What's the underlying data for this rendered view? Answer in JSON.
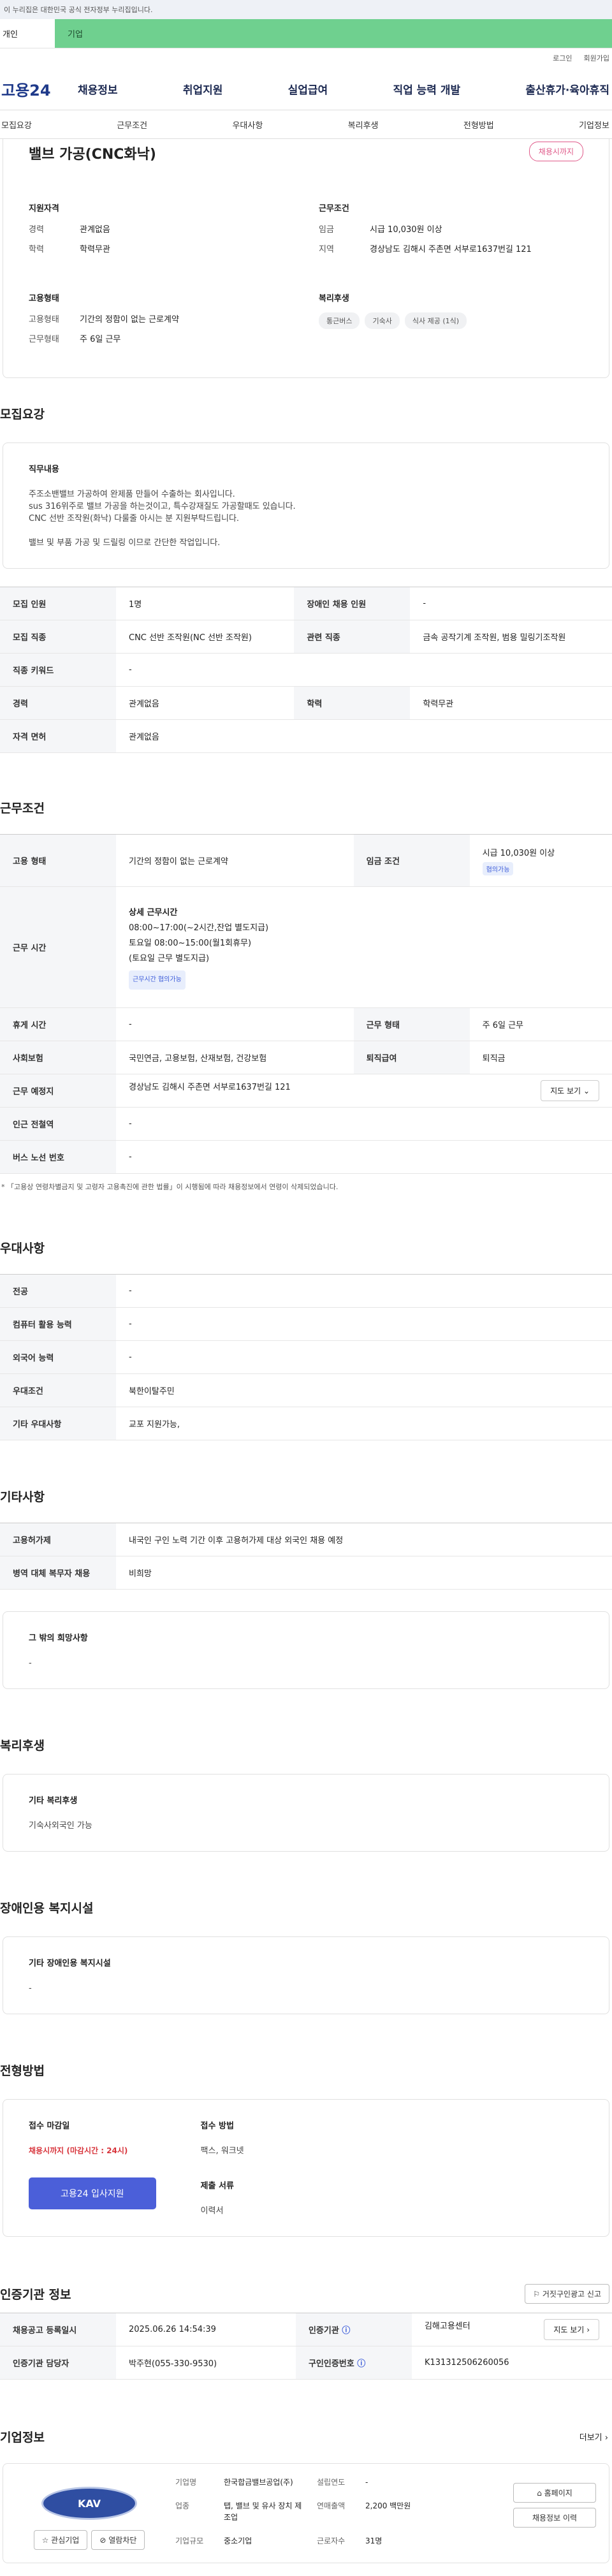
{
  "topbar": {
    "text": "이 누리집은 대한민국 공식 전자정부 누리집입니다."
  },
  "tabs": {
    "individual": "개인",
    "business": "기업"
  },
  "util": {
    "login": "로그인",
    "join": "회원가입"
  },
  "gnb": {
    "logo": "고용24",
    "menu": [
      "채용정보",
      "취업지원",
      "실업급여",
      "직업 능력 개발",
      "출산휴가·육아휴직"
    ]
  },
  "subnav": [
    "모집요강",
    "근무조건",
    "우대사항",
    "복리후생",
    "전형방법",
    "기업정보"
  ],
  "hero": {
    "title": "밸브 가공(CNC화낙)",
    "badge": "채용시까지",
    "qual_title": "지원자격",
    "qual": [
      {
        "k": "경력",
        "v": "관계없음"
      },
      {
        "k": "학력",
        "v": "학력무관"
      }
    ],
    "cond_title": "근무조건",
    "cond": [
      {
        "k": "임금",
        "v": "시급 10,030원 이상"
      },
      {
        "k": "지역",
        "v": "경상남도 김해시 주촌면 서부로1637번길 121"
      }
    ],
    "emp_title": "고용형태",
    "emp": [
      {
        "k": "고용형태",
        "v": "기간의 정함이 없는 근로계약"
      },
      {
        "k": "근무형태",
        "v": "주 6일 근무"
      }
    ],
    "welfare_title": "복리후생",
    "welfare": [
      "통근버스",
      "기숙사",
      "식사 제공 (1식)"
    ]
  },
  "recruit": {
    "title": "모집요강",
    "duty_title": "직무내용",
    "duty_lines": [
      "주조소밴밸브 가공하여 완제품 만들어 수출하는 회사입니다.",
      "sus 316위주로 밸브 가공을 하는것이고, 특수강재질도 가공할때도 있습니다.",
      "CNC 선반 조작원(화낙) 다룰줄 아시는 분 지원부탁드립니다.",
      "",
      "밸브 및 부품 가공 및 드릴링 이므로 간단한 작업입니다."
    ],
    "rows": [
      [
        {
          "k": "모집 인원",
          "v": "1명"
        },
        {
          "k": "장애인 채용 인원",
          "v": "-"
        }
      ],
      [
        {
          "k": "모집 직종",
          "v": "CNC 선반 조작원(NC 선반 조작원)"
        },
        {
          "k": "관련 직종",
          "v": "금속 공작기계 조작원, 범용 밀링기조작원"
        }
      ],
      [
        {
          "k": "직종 키워드",
          "v": "-"
        }
      ],
      [
        {
          "k": "경력",
          "v": "관계없음"
        },
        {
          "k": "학력",
          "v": "학력무관"
        }
      ],
      [
        {
          "k": "자격 면허",
          "v": "관계없음"
        }
      ]
    ]
  },
  "work": {
    "title": "근무조건",
    "emp_k": "고용 형태",
    "emp_v": "기간의 정함이 없는 근로계약",
    "wage_k": "임금 조건",
    "wage_v": "시급 10,030원 이상",
    "wage_chip": "협의가능",
    "time_k": "근무 시간",
    "time_lines": [
      "상세 근무시간",
      "08:00~17:00(~2시간,잔업 별도지급)",
      "토요일 08:00~15:00(월1회휴무)",
      "(토요일 근무 별도지급)"
    ],
    "time_chip": "근무시간 협의가능",
    "rows": [
      [
        {
          "k": "휴게 시간",
          "v": "-"
        },
        {
          "k": "근무 형태",
          "v": "주 6일 근무"
        }
      ],
      [
        {
          "k": "사회보험",
          "v": "국민연금, 고용보험, 산재보험, 건강보험"
        },
        {
          "k": "퇴직급여",
          "v": "퇴직금"
        }
      ]
    ],
    "place_k": "근무 예정지",
    "place_v": "경상남도 김해시 주촌면 서부로1637번길 121",
    "map_btn": "지도 보기",
    "station_k": "인근 전철역",
    "station_v": "-",
    "bus_k": "버스 노선 번호",
    "bus_v": "-",
    "note": "* 「고용상 연령차별금지 및 고령자 고용촉진에 관한 법률」이 시행됨에 따라 채용정보에서 연령이 삭제되었습니다."
  },
  "prefer": {
    "title": "우대사항",
    "rows": [
      {
        "k": "전공",
        "v": "-"
      },
      {
        "k": "컴퓨터 활용 능력",
        "v": "-"
      },
      {
        "k": "외국어 능력",
        "v": "-"
      },
      {
        "k": "우대조건",
        "v": "북한이탈주민"
      },
      {
        "k": "기타 우대사항",
        "v": "교포 지원가능,"
      }
    ]
  },
  "etc": {
    "title": "기타사항",
    "rows": [
      {
        "k": "고용허가제",
        "v": "내국인 구인 노력 기간 이후 고용허가제 대상 외국인 채용 예정"
      },
      {
        "k": "병역 대체 복무자 채용",
        "v": "비희망"
      }
    ],
    "box_title": "그 밖의 희망사항",
    "box_value": "-"
  },
  "welfare": {
    "title": "복리후생",
    "box_title": "기타 복리후생",
    "box_value": "기숙사외국인 가능"
  },
  "disabled": {
    "title": "장애인용 복지시설",
    "box_title": "기타 장애인용 복지시설",
    "box_value": "-"
  },
  "screening": {
    "title": "전형방법",
    "deadline_title": "접수 마감일",
    "deadline_value": "채용시까지 (마감시간 : 24시)",
    "apply_btn": "고용24 입사지원",
    "method_title": "접수 방법",
    "method_value": "팩스, 워크넷",
    "docs_title": "제출 서류",
    "docs_value": "이력서"
  },
  "cert": {
    "title": "인증기관 정보",
    "report_btn": "거짓구인광고 신고",
    "rows": [
      [
        {
          "k": "채용공고 등록일시",
          "v": "2025.06.26 14:54:39"
        },
        {
          "k": "인증기관",
          "v": "김해고용센터"
        }
      ],
      [
        {
          "k": "인증기관 담당자",
          "v": "박주현(055-330-9530)"
        },
        {
          "k": "구인인증번호",
          "v": "K131312506260056"
        }
      ]
    ],
    "map_btn": "지도 보기"
  },
  "company": {
    "title": "기업정보",
    "more": "더보기",
    "logo_text": "KAV",
    "interest_btn": "관심기업",
    "block_btn": "열람차단",
    "name_k": "기업명",
    "name_v": "한국합금밸브공업(주)",
    "biz_k": "업종",
    "biz_v": "탭, 밸브 및 유사 장치 제조업",
    "size_k": "기업규모",
    "size_v": "중소기업",
    "year_k": "설립연도",
    "year_v": "-",
    "sales_k": "연매출액",
    "sales_v": "2,200 백만원",
    "emp_k": "근로자수",
    "emp_v": "31명",
    "home_btn": "홈페이지",
    "hire_btn": "채용정보 이력"
  }
}
